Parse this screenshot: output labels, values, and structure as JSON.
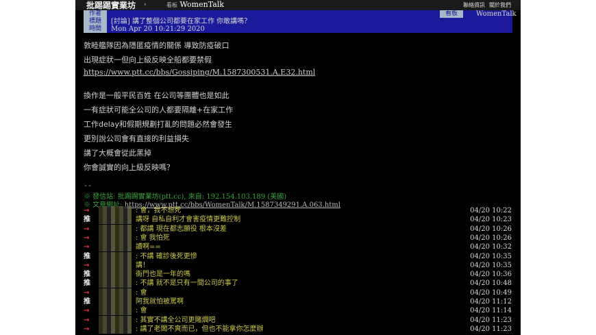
{
  "header": {
    "site_name": "批踢踢實業坊",
    "crumb_arrow": "›",
    "board_label": "看板",
    "board_name": "WomenTalk",
    "link_contact": "聯絡資訊",
    "link_about": "關於我們"
  },
  "meta": {
    "author_label": "作者",
    "author_value": "",
    "board_label": "看板",
    "board_value": "WomenTalk",
    "title_label": "標題",
    "title_value": "[討論] 講了整個公司都要在家工作 你敢講嗎？",
    "time_label": "時間",
    "time_value": "Mon Apr 20 10:21:29 2020"
  },
  "body": {
    "lines": [
      "敦睦艦隊因為隱匿疫情的關係 導致防疫破口",
      "出現症狀一但向上級反映全船都要禁假",
      "https://www.ptt.cc/bbs/Gossiping/M.1587300531.A.E32.html",
      "換作是一般平民百姓 在公司等團體也是如此",
      "一有症狀可能全公司的人都要隔離+在家工作",
      "工作delay和假期規劃打亂的問題必然會發生",
      "更別說公司會有直接的利益損失",
      "講了大概會從此黑掉",
      "你會誠實的向上級反映嗎？"
    ]
  },
  "signature": {
    "separator": "--",
    "line1": "※ 發信站: 批踢踢實業坊(ptt.cc), 來自: 192.154.103.189 (美國)",
    "line2_prefix": "※ 文章網址: ",
    "line2_url": "https://www.ptt.cc/bbs/WomenTalk/M.1587349291.A.063.html"
  },
  "pushes": [
    {
      "tag": "→",
      "kind": "arrow",
      "text": ": 會，我不想死",
      "time": "04/20 10:22"
    },
    {
      "tag": "推",
      "kind": "up",
      "text": "講呀 自私自利才會害疫情更難控制",
      "time": "04/20 10:23"
    },
    {
      "tag": "→",
      "kind": "arrow",
      "text": ": 都講 現在都志願役 根本沒差",
      "time": "04/20 10:26"
    },
    {
      "tag": "→",
      "kind": "arrow",
      "text": ": 會 我怕死",
      "time": "04/20 10:26"
    },
    {
      "tag": "→",
      "kind": "arrow",
      "text": "讀啊==",
      "time": "04/20 10:32"
    },
    {
      "tag": "推",
      "kind": "up",
      "text": ": 不講 確診後死更慘",
      "time": "04/20 10:35"
    },
    {
      "tag": "→",
      "kind": "arrow",
      "text": "講！",
      "time": "04/20 10:35"
    },
    {
      "tag": "推",
      "kind": "up",
      "text": "衙門也是一年的嗎",
      "time": "04/20 10:36"
    },
    {
      "tag": "推",
      "kind": "up",
      "text": ": 不講 就不是只有一間公司的事了",
      "time": "04/20 10:48"
    },
    {
      "tag": "→",
      "kind": "arrow",
      "text": ": 會",
      "time": "04/20 10:49"
    },
    {
      "tag": "推",
      "kind": "up",
      "text": "阿我就怕被罵啊",
      "time": "04/20 11:12"
    },
    {
      "tag": "→",
      "kind": "arrow",
      "text": ": 會",
      "time": "04/20 11:14"
    },
    {
      "tag": "→",
      "kind": "arrow",
      "text": ": 其實不講全公司更賭爛吧",
      "time": "04/20 11:23"
    },
    {
      "tag": "→",
      "kind": "arrow",
      "text": ": 講了老闆不爽而已，但也不能拿你怎麼辦",
      "time": "04/20 11:23"
    }
  ]
}
